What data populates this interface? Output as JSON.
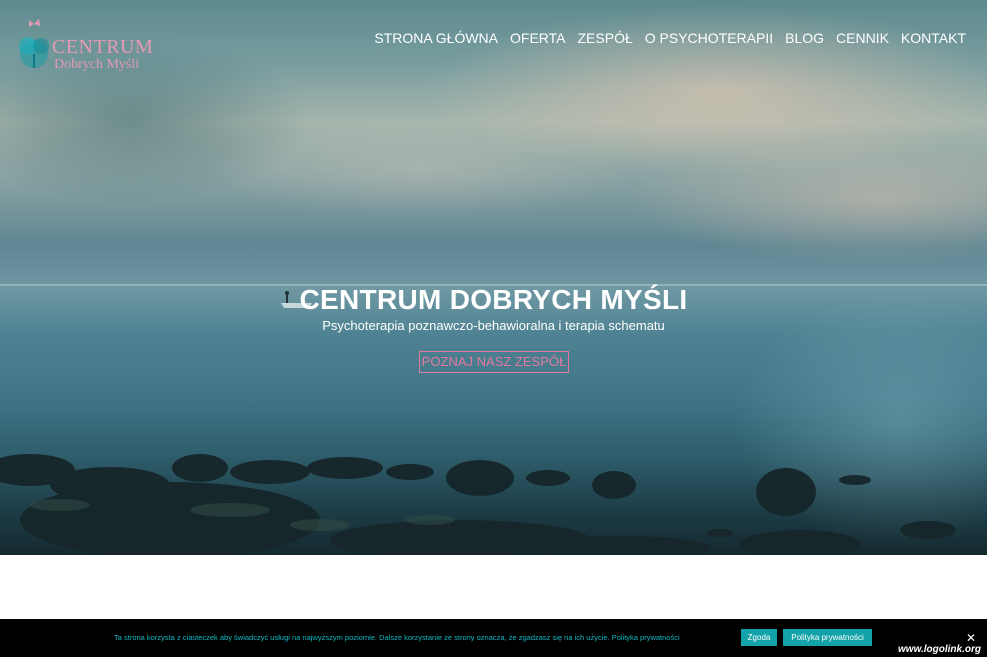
{
  "brand": {
    "name_line1": "CENTRUM",
    "name_line2": "Dobrych Myśli",
    "color": "#e39ab3"
  },
  "nav": {
    "items": [
      {
        "label": "STRONA GŁÓWNA"
      },
      {
        "label": "OFERTA"
      },
      {
        "label": "ZESPÓŁ"
      },
      {
        "label": "O PSYCHOTERAPII"
      },
      {
        "label": "BLOG"
      },
      {
        "label": "CENNIK"
      },
      {
        "label": "KONTAKT"
      }
    ]
  },
  "hero": {
    "title": "CENTRUM DOBRYCH MYŚLI",
    "subtitle": "Psychoterapia poznawczo-behawioralna i terapia schematu",
    "cta_label": "POZNAJ NASZ ZESPÓŁ",
    "accent_color": "#e07b9e"
  },
  "cookie_bar": {
    "text": "Ta strona korzysta z ciasteczek aby świadczyć usługi na najwyższym poziomie. Dalsze korzystanie ze strony oznacza, że zgadzasz się na ich użycie. Polityka prywatności",
    "agree_label": "Zgoda",
    "policy_label": "Polityka prywatności",
    "close_icon": "close-icon",
    "text_color": "#11b7c4",
    "button_color": "#12a2a8"
  },
  "watermark": "www.logolink.org"
}
